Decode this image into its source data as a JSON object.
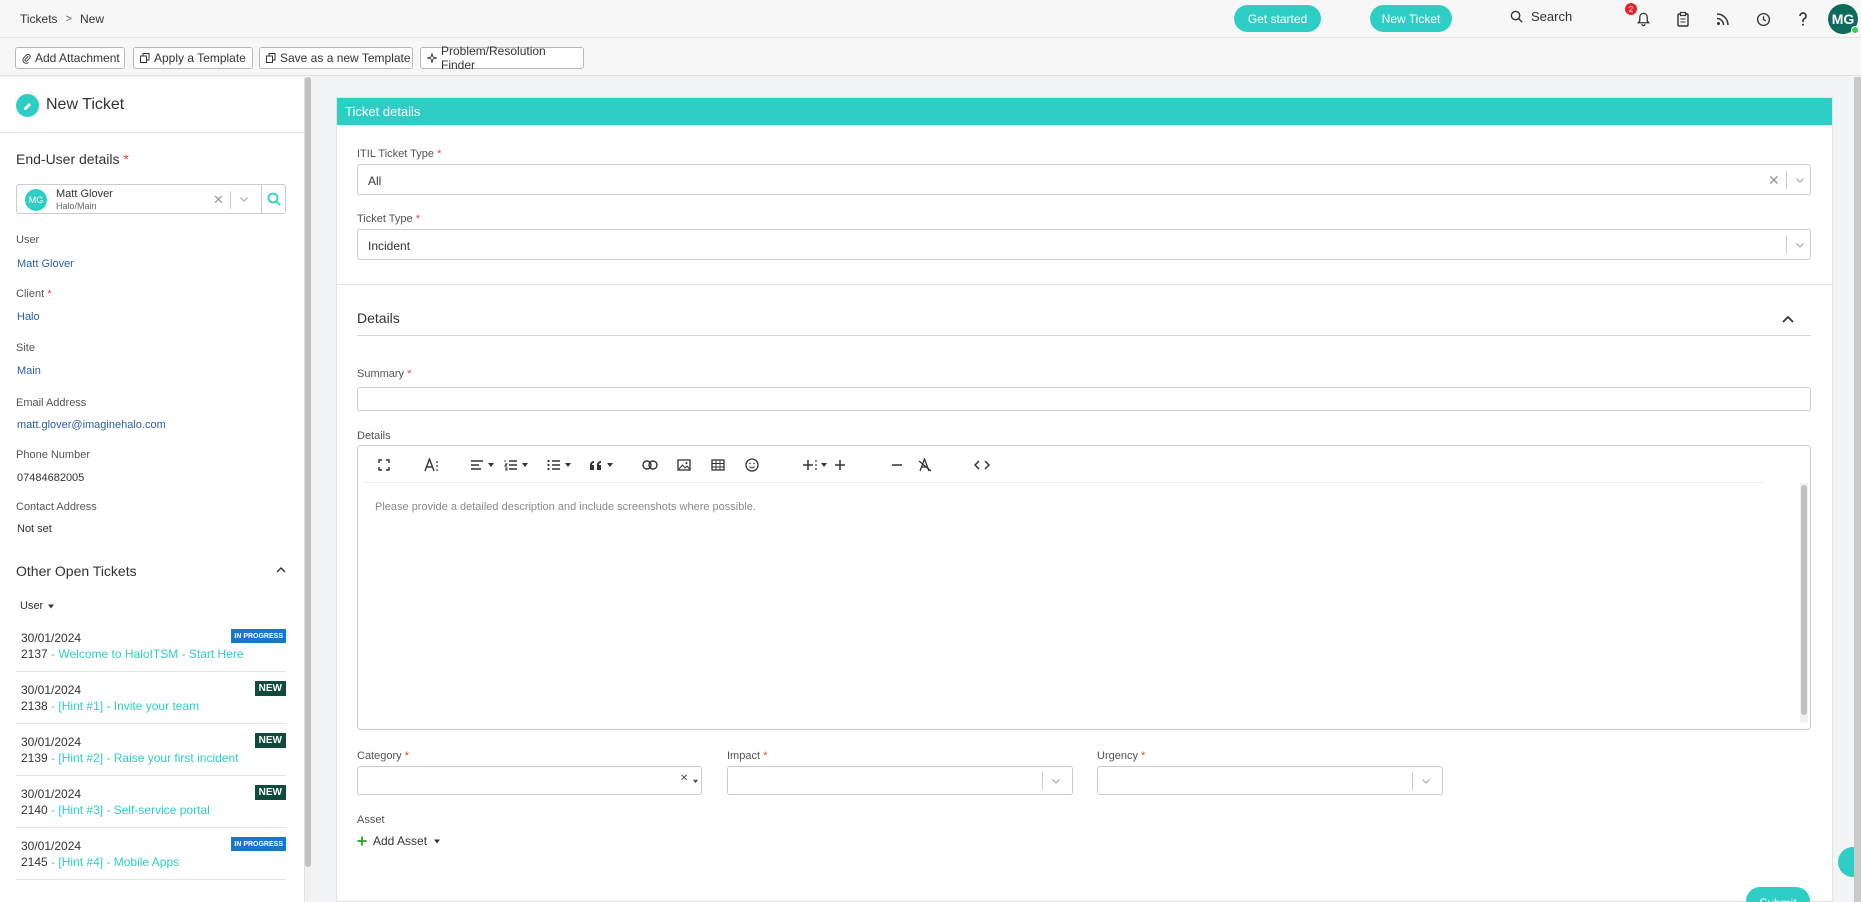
{
  "breadcrumb": {
    "parent": "Tickets",
    "separator": ">",
    "current": "New"
  },
  "topbar": {
    "get_started": "Get started",
    "new_ticket": "New Ticket",
    "search": "Search",
    "notification_count": "2",
    "avatar": "MG",
    "icons": [
      "bell-icon",
      "clipboard-icon",
      "rss-icon",
      "clock-icon",
      "help-icon"
    ]
  },
  "actions": {
    "add_attachment": "Add Attachment",
    "apply_template": "Apply a Template",
    "save_template": "Save as a new Template",
    "problem_finder": "Problem/Resolution Finder"
  },
  "left": {
    "title": "New Ticket",
    "end_user_title": "End-User details",
    "end_user": {
      "initials": "MG",
      "name": "Matt Glover",
      "sub": "Halo/Main"
    },
    "fields": [
      {
        "label": "User",
        "value": "Matt Glover",
        "required": ""
      },
      {
        "label": "Client",
        "value": "Halo",
        "required": "*"
      },
      {
        "label": "Site",
        "value": "Main",
        "required": ""
      },
      {
        "label": "Email Address",
        "value": "matt.glover@imaginehalo.com",
        "required": ""
      },
      {
        "label": "Phone Number",
        "value": "07484682005",
        "required": ""
      },
      {
        "label": "Contact Address",
        "value": "Not set",
        "required": ""
      }
    ],
    "other_open_tickets": "Other Open Tickets",
    "filter": "User",
    "tickets": [
      {
        "date": "30/01/2024",
        "id": "2137",
        "title": "Welcome to HaloITSM - Start Here",
        "status": "IN PROGRESS"
      },
      {
        "date": "30/01/2024",
        "id": "2138",
        "title": "[Hint #1] - Invite your team",
        "status": "NEW"
      },
      {
        "date": "30/01/2024",
        "id": "2139",
        "title": "[Hint #2] - Raise your first incident",
        "status": "NEW"
      },
      {
        "date": "30/01/2024",
        "id": "2140",
        "title": "[Hint #3] - Self-service portal",
        "status": "NEW"
      },
      {
        "date": "30/01/2024",
        "id": "2145",
        "title": "[Hint #4] - Mobile Apps",
        "status": "IN PROGRESS"
      }
    ]
  },
  "form": {
    "header": "Ticket details",
    "itil_label": "ITIL Ticket Type",
    "itil_value": "All",
    "type_label": "Ticket Type",
    "type_value": "Incident",
    "details_section": "Details",
    "summary_label": "Summary",
    "details_label": "Details",
    "editor_placeholder": "Please provide a detailed description and include screenshots where possible.",
    "category_label": "Category",
    "impact_label": "Impact",
    "urgency_label": "Urgency",
    "asset_label": "Asset",
    "add_asset": "Add Asset",
    "submit": "Submit",
    "required_mark": "*"
  },
  "colors": {
    "accent": "#2ecec4",
    "badge_progress": "#1a76c9",
    "badge_new": "#0f4a3a",
    "link": "#2b5fa8"
  }
}
